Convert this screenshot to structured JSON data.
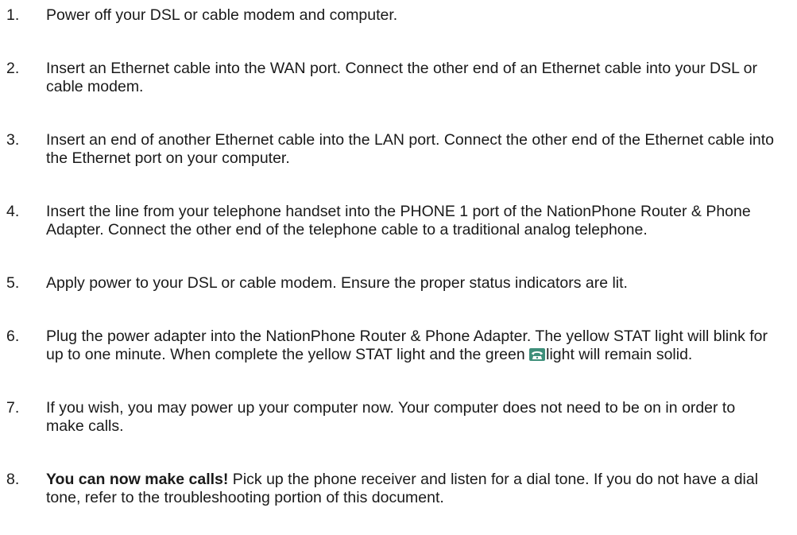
{
  "steps": [
    {
      "number": "1.",
      "text": "Power off your DSL or cable modem and computer."
    },
    {
      "number": "2.",
      "text": "Insert an Ethernet cable into the WAN port. Connect the other end of an Ethernet cable into your DSL or cable modem."
    },
    {
      "number": "3.",
      "text": "Insert an end of another Ethernet cable into the LAN port. Connect the other end of the Ethernet cable into the Ethernet port on your computer."
    },
    {
      "number": "4.",
      "text": "Insert the line from your telephone handset into the PHONE 1 port of the NationPhone Router & Phone Adapter. Connect the other end of the telephone cable to a traditional analog telephone."
    },
    {
      "number": "5.",
      "text": "Apply power to your DSL or cable modem. Ensure the proper status indicators are lit."
    },
    {
      "number": "6.",
      "text_before_icon": "Plug the power adapter into the NationPhone Router & Phone Adapter. The yellow STAT light will blink for up to one minute. When complete the yellow STAT light and the green ",
      "icon": "telephone-icon",
      "text_after_icon": "light will remain solid."
    },
    {
      "number": "7.",
      "text": "If you wish, you may power up your computer now. Your computer does not need to be on in order to make calls."
    },
    {
      "number": "8.",
      "lead": "You can now make calls!",
      "text": " Pick up the phone receiver and listen for a dial tone. If you do not have a dial tone, refer to the troubleshooting portion of this document."
    }
  ]
}
